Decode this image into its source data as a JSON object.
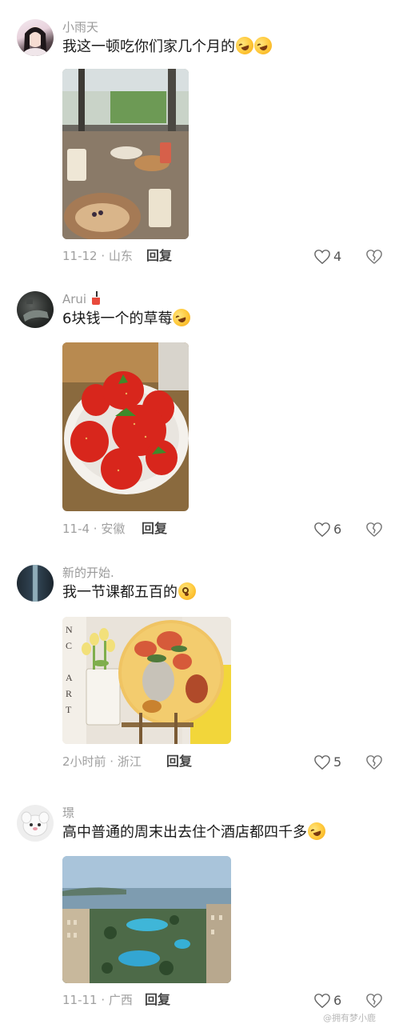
{
  "comments": [
    {
      "username": "小雨天",
      "text": "我这一顿吃你们家几个月的",
      "meta": "11-12 · 山东",
      "reply_label": "回复",
      "likes": "4"
    },
    {
      "username": "Arui",
      "text": "6块钱一个的草莓",
      "meta": "11-4 · 安徽",
      "reply_label": "回复",
      "likes": "6"
    },
    {
      "username": "新的开始.",
      "text": "我一节课都五百的",
      "meta": "2小时前 · 浙江",
      "reply_label": "回复",
      "likes": "5"
    },
    {
      "username": "璟",
      "text": "高中普通的周末出去住个酒店都四千多",
      "meta": "11-11 · 广西",
      "reply_label": "回复",
      "likes": "6"
    }
  ],
  "watermark": "@拥有梦小鹿",
  "icons": {
    "like": "heart-outline-icon",
    "dislike": "broken-heart-icon",
    "emoji_laugh": "rolling-on-floor-laughing-emoji",
    "emoji_flush": "flushed-face-emoji",
    "username_badge": "drink-cup-icon"
  },
  "colors": {
    "username": "#9a9a9a",
    "meta": "#a0a0a0",
    "text": "#1a1a1a"
  }
}
